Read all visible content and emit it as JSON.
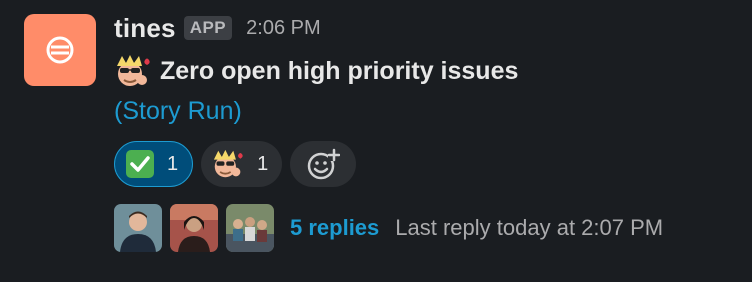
{
  "message": {
    "sender": "tines",
    "badge": "APP",
    "timestamp": "2:06 PM",
    "app_avatar_icon": "tines-logo-icon",
    "app_avatar_color": "#ff8c69",
    "text_emoji": "guy-fieri-emoji",
    "text": "Zero open high priority issues",
    "link_text": "(Story Run)",
    "link_color": "#1d9bd1"
  },
  "reactions": [
    {
      "emoji": "white-check-mark",
      "glyph": "✅",
      "count": "1",
      "active": true
    },
    {
      "emoji": "guy-fieri-emoji",
      "count": "1",
      "active": false
    }
  ],
  "add_reaction_icon": "add-reaction-icon",
  "thread": {
    "avatars": [
      "user-avatar-1",
      "user-avatar-2",
      "user-avatar-3"
    ],
    "replies_text": "5 replies",
    "last_reply_text": "Last reply today at 2:07 PM"
  }
}
